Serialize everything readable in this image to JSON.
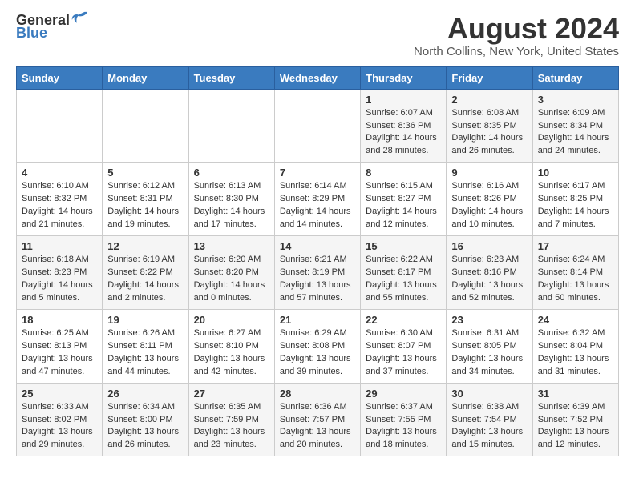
{
  "header": {
    "logo_line1": "General",
    "logo_line2": "Blue",
    "main_title": "August 2024",
    "subtitle": "North Collins, New York, United States"
  },
  "days_of_week": [
    "Sunday",
    "Monday",
    "Tuesday",
    "Wednesday",
    "Thursday",
    "Friday",
    "Saturday"
  ],
  "weeks": [
    [
      {
        "day": "",
        "info": ""
      },
      {
        "day": "",
        "info": ""
      },
      {
        "day": "",
        "info": ""
      },
      {
        "day": "",
        "info": ""
      },
      {
        "day": "1",
        "info": "Sunrise: 6:07 AM\nSunset: 8:36 PM\nDaylight: 14 hours\nand 28 minutes."
      },
      {
        "day": "2",
        "info": "Sunrise: 6:08 AM\nSunset: 8:35 PM\nDaylight: 14 hours\nand 26 minutes."
      },
      {
        "day": "3",
        "info": "Sunrise: 6:09 AM\nSunset: 8:34 PM\nDaylight: 14 hours\nand 24 minutes."
      }
    ],
    [
      {
        "day": "4",
        "info": "Sunrise: 6:10 AM\nSunset: 8:32 PM\nDaylight: 14 hours\nand 21 minutes."
      },
      {
        "day": "5",
        "info": "Sunrise: 6:12 AM\nSunset: 8:31 PM\nDaylight: 14 hours\nand 19 minutes."
      },
      {
        "day": "6",
        "info": "Sunrise: 6:13 AM\nSunset: 8:30 PM\nDaylight: 14 hours\nand 17 minutes."
      },
      {
        "day": "7",
        "info": "Sunrise: 6:14 AM\nSunset: 8:29 PM\nDaylight: 14 hours\nand 14 minutes."
      },
      {
        "day": "8",
        "info": "Sunrise: 6:15 AM\nSunset: 8:27 PM\nDaylight: 14 hours\nand 12 minutes."
      },
      {
        "day": "9",
        "info": "Sunrise: 6:16 AM\nSunset: 8:26 PM\nDaylight: 14 hours\nand 10 minutes."
      },
      {
        "day": "10",
        "info": "Sunrise: 6:17 AM\nSunset: 8:25 PM\nDaylight: 14 hours\nand 7 minutes."
      }
    ],
    [
      {
        "day": "11",
        "info": "Sunrise: 6:18 AM\nSunset: 8:23 PM\nDaylight: 14 hours\nand 5 minutes."
      },
      {
        "day": "12",
        "info": "Sunrise: 6:19 AM\nSunset: 8:22 PM\nDaylight: 14 hours\nand 2 minutes."
      },
      {
        "day": "13",
        "info": "Sunrise: 6:20 AM\nSunset: 8:20 PM\nDaylight: 14 hours\nand 0 minutes."
      },
      {
        "day": "14",
        "info": "Sunrise: 6:21 AM\nSunset: 8:19 PM\nDaylight: 13 hours\nand 57 minutes."
      },
      {
        "day": "15",
        "info": "Sunrise: 6:22 AM\nSunset: 8:17 PM\nDaylight: 13 hours\nand 55 minutes."
      },
      {
        "day": "16",
        "info": "Sunrise: 6:23 AM\nSunset: 8:16 PM\nDaylight: 13 hours\nand 52 minutes."
      },
      {
        "day": "17",
        "info": "Sunrise: 6:24 AM\nSunset: 8:14 PM\nDaylight: 13 hours\nand 50 minutes."
      }
    ],
    [
      {
        "day": "18",
        "info": "Sunrise: 6:25 AM\nSunset: 8:13 PM\nDaylight: 13 hours\nand 47 minutes."
      },
      {
        "day": "19",
        "info": "Sunrise: 6:26 AM\nSunset: 8:11 PM\nDaylight: 13 hours\nand 44 minutes."
      },
      {
        "day": "20",
        "info": "Sunrise: 6:27 AM\nSunset: 8:10 PM\nDaylight: 13 hours\nand 42 minutes."
      },
      {
        "day": "21",
        "info": "Sunrise: 6:29 AM\nSunset: 8:08 PM\nDaylight: 13 hours\nand 39 minutes."
      },
      {
        "day": "22",
        "info": "Sunrise: 6:30 AM\nSunset: 8:07 PM\nDaylight: 13 hours\nand 37 minutes."
      },
      {
        "day": "23",
        "info": "Sunrise: 6:31 AM\nSunset: 8:05 PM\nDaylight: 13 hours\nand 34 minutes."
      },
      {
        "day": "24",
        "info": "Sunrise: 6:32 AM\nSunset: 8:04 PM\nDaylight: 13 hours\nand 31 minutes."
      }
    ],
    [
      {
        "day": "25",
        "info": "Sunrise: 6:33 AM\nSunset: 8:02 PM\nDaylight: 13 hours\nand 29 minutes."
      },
      {
        "day": "26",
        "info": "Sunrise: 6:34 AM\nSunset: 8:00 PM\nDaylight: 13 hours\nand 26 minutes."
      },
      {
        "day": "27",
        "info": "Sunrise: 6:35 AM\nSunset: 7:59 PM\nDaylight: 13 hours\nand 23 minutes."
      },
      {
        "day": "28",
        "info": "Sunrise: 6:36 AM\nSunset: 7:57 PM\nDaylight: 13 hours\nand 20 minutes."
      },
      {
        "day": "29",
        "info": "Sunrise: 6:37 AM\nSunset: 7:55 PM\nDaylight: 13 hours\nand 18 minutes."
      },
      {
        "day": "30",
        "info": "Sunrise: 6:38 AM\nSunset: 7:54 PM\nDaylight: 13 hours\nand 15 minutes."
      },
      {
        "day": "31",
        "info": "Sunrise: 6:39 AM\nSunset: 7:52 PM\nDaylight: 13 hours\nand 12 minutes."
      }
    ]
  ]
}
